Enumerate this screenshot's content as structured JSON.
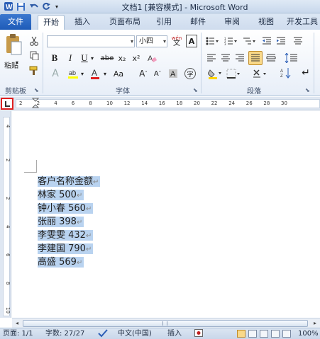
{
  "window": {
    "title": "文档1 [兼容模式] - Microsoft Word"
  },
  "tabs": {
    "file": "文件",
    "items": [
      "开始",
      "插入",
      "页面布局",
      "引用",
      "邮件",
      "审阅",
      "视图",
      "开发工具"
    ],
    "active_index": 0
  },
  "ribbon": {
    "clipboard": {
      "paste_label": "粘贴",
      "group_label": "剪贴板"
    },
    "font": {
      "font_name": "",
      "font_size": "小四",
      "group_label": "字体",
      "bold": "B",
      "italic": "I",
      "underline": "U",
      "strike": "abe",
      "sub": "x₂",
      "sup": "x²",
      "grow": "A",
      "shrink": "A",
      "case": "Aa",
      "wen": "wén",
      "a_box": "A",
      "circle": "字"
    },
    "paragraph": {
      "group_label": "段落"
    }
  },
  "ruler": {
    "marks": [
      "2",
      "2",
      "4",
      "6",
      "8",
      "10",
      "12",
      "14",
      "16",
      "18",
      "20",
      "22",
      "24",
      "26",
      "28",
      "30"
    ],
    "v_marks": [
      "4",
      "2",
      "2",
      "4",
      "6",
      "8",
      "10"
    ]
  },
  "document": {
    "lines": [
      "客户名称金额",
      "林家 500",
      "钟小春 560",
      "张丽 398",
      "李雯雯 432",
      "李建国 790",
      "高盛 569"
    ],
    "paragraph_mark": "↵"
  },
  "statusbar": {
    "page": "页面: 1/1",
    "words": "字数: 27/27",
    "language": "中文(中国)",
    "mode": "插入",
    "zoom": "100%"
  },
  "colors": {
    "selection": "#b9d3f0",
    "file_tab": "#2a66c2",
    "tab_selector_border": "#e02020"
  }
}
